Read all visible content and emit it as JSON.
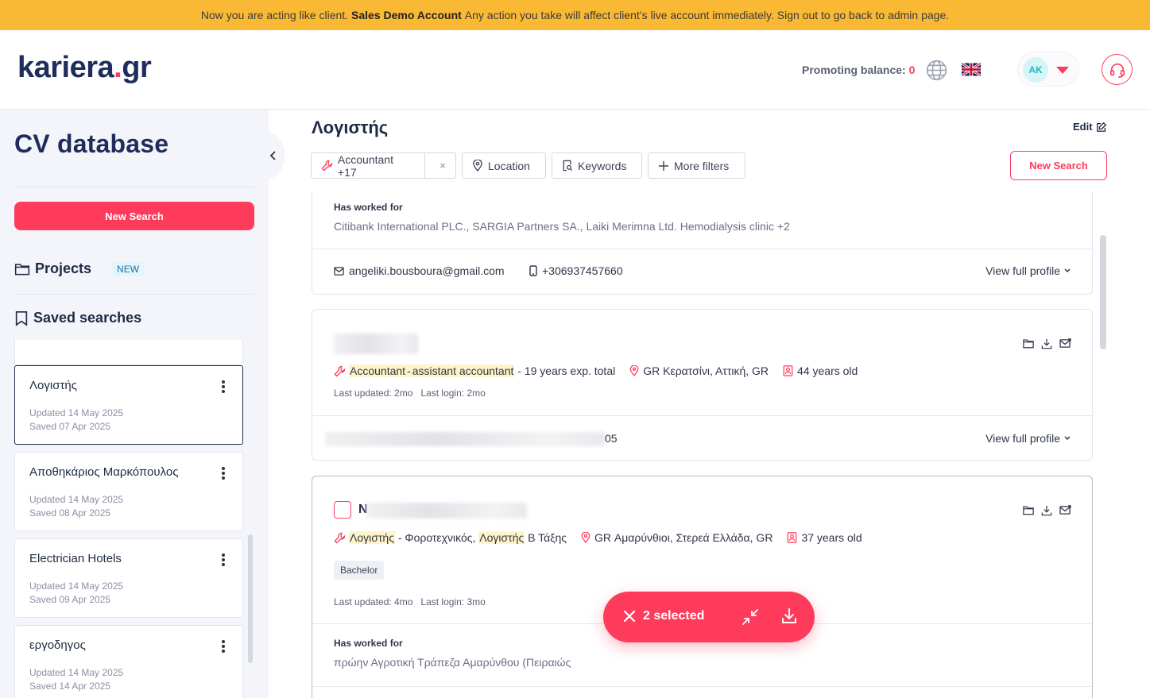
{
  "banner": {
    "prefix": "Now you are acting like client.",
    "account": "Sales Demo Account",
    "suffix": "Any action you take will affect client’s live account immediately. Sign out to go back to admin page."
  },
  "header": {
    "logo_main": "kariera",
    "logo_dot": ".",
    "logo_tld": "gr",
    "promo_label": "Promoting balance:",
    "promo_value": "0",
    "avatar_initials": "AK"
  },
  "sidebar": {
    "title": "CV database",
    "new_search": "New Search",
    "projects": "Projects",
    "projects_badge": "NEW",
    "saved_searches": "Saved searches",
    "items": [
      {
        "name": "Λογιστής",
        "updated": "Updated  14 May 2025",
        "saved": "Saved  07 Apr 2025"
      },
      {
        "name": "Αποθηκάριος Μαρκόπουλος",
        "updated": "Updated  14 May 2025",
        "saved": "Saved  08 Apr 2025"
      },
      {
        "name": "Electrician Hotels",
        "updated": "Updated  14 May 2025",
        "saved": "Saved  09 Apr 2025"
      },
      {
        "name": "εργοδηγος",
        "updated": "Updated  14 May 2025",
        "saved": "Saved  14 Apr 2025"
      }
    ]
  },
  "main": {
    "title": "Λογιστής",
    "edit": "Edit",
    "new_search": "New Search",
    "filters": {
      "profession": "Accountant +17",
      "clear": "×",
      "location": "Location",
      "keywords": "Keywords",
      "more": "More filters"
    }
  },
  "results": {
    "card1": {
      "worked_label": "Has worked for",
      "worked_value": "Citibank International PLC., SARGIA Partners SA., Laiki Merimna Ltd. Hemodialysis clinic +2",
      "email": "angeliki.bousboura@gmail.com",
      "phone": "+306937457660",
      "view": "View full profile"
    },
    "card2": {
      "title_hl1": "Accountant",
      "title_sep": "-",
      "title_hl2": "assistant accountant",
      "exp": " - 19 years exp. total",
      "location": "GR Κερατσίνι, Αττική, GR",
      "age": "44 years old",
      "last_updated": "Last updated: 2mo",
      "last_login": "Last login: 2mo",
      "partial_phone": "05",
      "view": "View full profile"
    },
    "card3": {
      "name_initial": "N",
      "title_hl1": "Λογιστής",
      "title_mid": " - Φοροτεχνικός, ",
      "title_hl2": "Λογιστής",
      "title_end": " Β Τάξης",
      "location": "GR Αμαρύνθιοι, Στερεά Ελλάδα, GR",
      "age": "37 years old",
      "education": "Bachelor",
      "last_updated": "Last updated: 4mo",
      "last_login": "Last login: 3mo",
      "worked_label": "Has worked for",
      "worked_value": "πρώην Αγροτική Τράπεζα Αμαρύνθου (Πειραιώς"
    }
  },
  "selection": {
    "count": "2 selected"
  },
  "colors": {
    "accent": "#ff3b5c",
    "banner": "#f9b934",
    "navy": "#1f2d5c"
  }
}
